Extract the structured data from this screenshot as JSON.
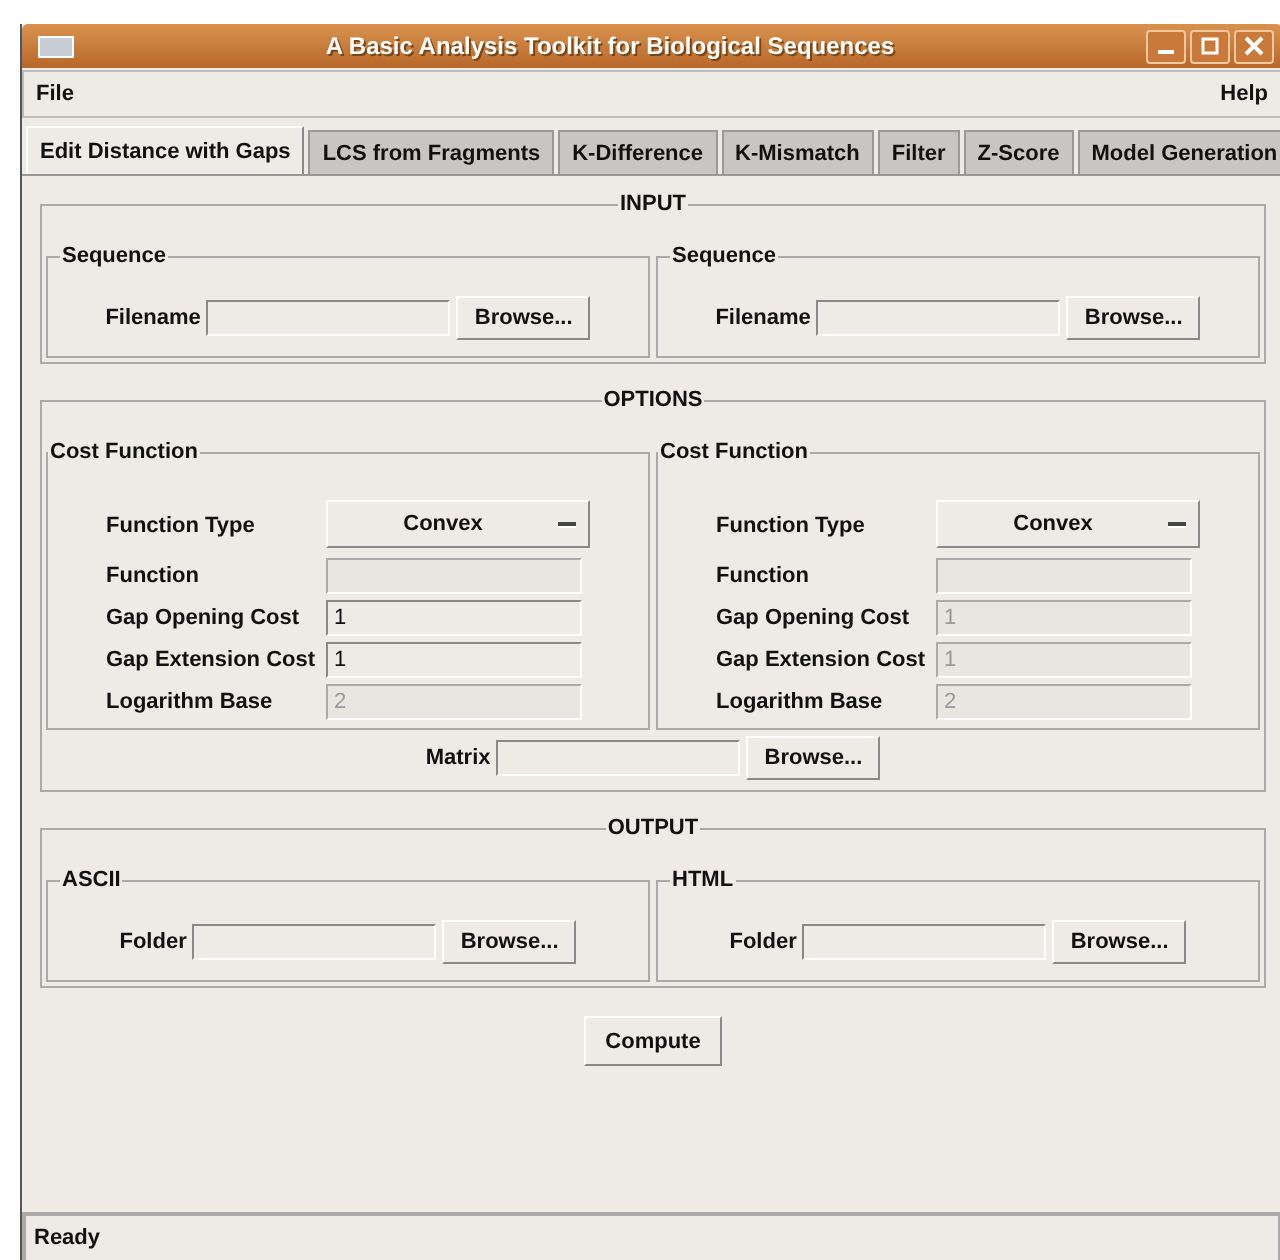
{
  "window": {
    "title": "A Basic Analysis Toolkit for Biological Sequences"
  },
  "menu": [
    {
      "label": "File"
    },
    {
      "label": "Help"
    }
  ],
  "tabs": [
    {
      "label": "Edit Distance with Gaps",
      "selected": true
    },
    {
      "label": "LCS from Fragments",
      "selected": false
    },
    {
      "label": "K-Difference",
      "selected": false
    },
    {
      "label": "K-Mismatch",
      "selected": false
    },
    {
      "label": "Filter",
      "selected": false
    },
    {
      "label": "Z-Score",
      "selected": false
    },
    {
      "label": "Model Generation",
      "selected": false
    }
  ],
  "input": {
    "title": "INPUT",
    "groups": [
      {
        "title": "Sequence",
        "label": "Filename",
        "button": "Browse..."
      },
      {
        "title": "Sequence",
        "label": "Filename",
        "button": "Browse..."
      }
    ]
  },
  "options": {
    "title": "OPTIONS",
    "groups": [
      {
        "title": "Cost Function",
        "rows": [
          {
            "kind": "dropdown",
            "label": "Function Type",
            "value": "Convex",
            "disabled": false
          },
          {
            "kind": "field",
            "label": "Function",
            "disabled": true
          },
          {
            "kind": "field",
            "label": "Gap Opening Cost",
            "value": "1",
            "disabled": false
          },
          {
            "kind": "field",
            "label": "Gap Extension Cost",
            "value": "1",
            "disabled": false
          },
          {
            "kind": "field",
            "label": "Logarithm Base",
            "value": "2",
            "disabled": true
          }
        ]
      },
      {
        "title": "Cost Function",
        "rows": [
          {
            "kind": "dropdown",
            "label": "Function Type",
            "value": "Convex",
            "disabled": false
          },
          {
            "kind": "field",
            "label": "Function",
            "disabled": true
          },
          {
            "kind": "field",
            "label": "Gap Opening Cost",
            "value": "1",
            "disabled": true
          },
          {
            "kind": "field",
            "label": "Gap Extension Cost",
            "value": "1",
            "disabled": true
          },
          {
            "kind": "field",
            "label": "Logarithm Base",
            "value": "2",
            "disabled": true
          }
        ]
      }
    ],
    "matrix": {
      "label": "Matrix",
      "button": "Browse..."
    }
  },
  "output": {
    "title": "OUTPUT",
    "groups": [
      {
        "title": "ASCII",
        "label": "Folder",
        "button": "Browse..."
      },
      {
        "title": "HTML",
        "label": "Folder",
        "button": "Browse..."
      }
    ]
  },
  "compute": {
    "label": "Compute"
  },
  "status_bar": {
    "text": "Ready"
  }
}
